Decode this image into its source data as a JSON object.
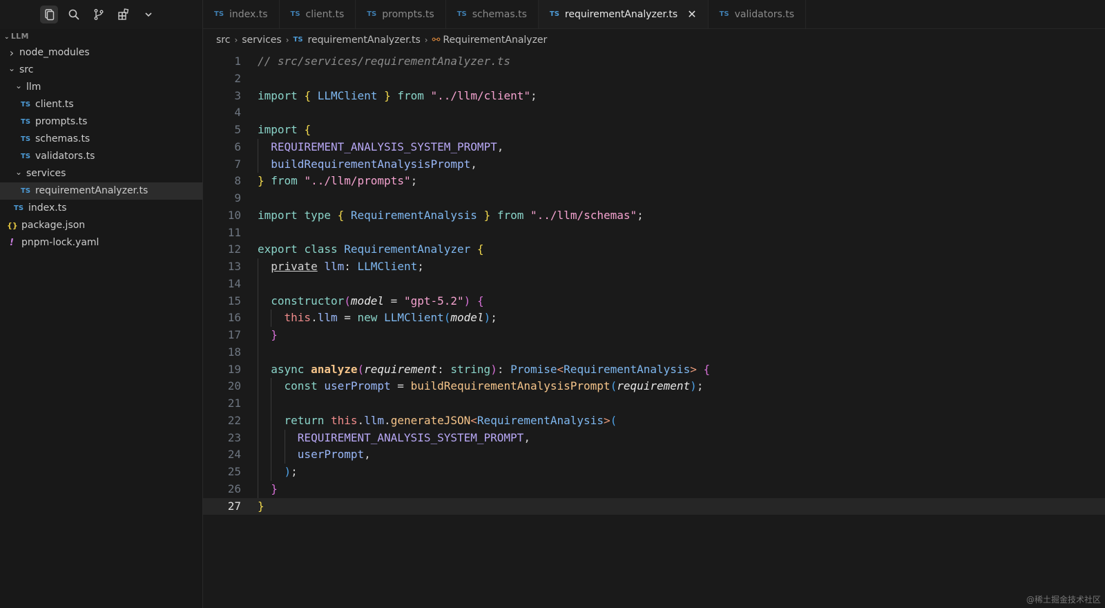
{
  "tabs": [
    {
      "badge": "TS",
      "label": "index.ts",
      "active": false
    },
    {
      "badge": "TS",
      "label": "client.ts",
      "active": false
    },
    {
      "badge": "TS",
      "label": "prompts.ts",
      "active": false
    },
    {
      "badge": "TS",
      "label": "schemas.ts",
      "active": false
    },
    {
      "badge": "TS",
      "label": "requirementAnalyzer.ts",
      "active": true
    },
    {
      "badge": "TS",
      "label": "validators.ts",
      "active": false
    }
  ],
  "explorer": {
    "root": "LLM",
    "items": [
      {
        "label": "node_modules",
        "kind": "folder",
        "open": false,
        "depth": 0
      },
      {
        "label": "src",
        "kind": "folder",
        "open": true,
        "depth": 0
      },
      {
        "label": "llm",
        "kind": "folder",
        "open": true,
        "depth": 1
      },
      {
        "label": "client.ts",
        "kind": "ts",
        "depth": 2
      },
      {
        "label": "prompts.ts",
        "kind": "ts",
        "depth": 2
      },
      {
        "label": "schemas.ts",
        "kind": "ts",
        "depth": 2
      },
      {
        "label": "validators.ts",
        "kind": "ts",
        "depth": 2
      },
      {
        "label": "services",
        "kind": "folder",
        "open": true,
        "depth": 1
      },
      {
        "label": "requirementAnalyzer.ts",
        "kind": "ts",
        "depth": 2,
        "selected": true
      },
      {
        "label": "index.ts",
        "kind": "ts",
        "depth": 1
      },
      {
        "label": "package.json",
        "kind": "json",
        "depth": 0
      },
      {
        "label": "pnpm-lock.yaml",
        "kind": "yaml",
        "depth": 0
      }
    ]
  },
  "breadcrumb": {
    "parts": [
      "src",
      "services"
    ],
    "file_badge": "TS",
    "file": "requirementAnalyzer.ts",
    "symbol": "RequirementAnalyzer"
  },
  "editor": {
    "current_line": 27,
    "lines": [
      [
        [
          "c-comment",
          "// src/services/requirementAnalyzer.ts"
        ]
      ],
      [],
      [
        [
          "c-kw",
          "import"
        ],
        [
          "c-punc",
          " "
        ],
        [
          "c-br1",
          "{"
        ],
        [
          "c-punc",
          " "
        ],
        [
          "c-type",
          "LLMClient"
        ],
        [
          "c-punc",
          " "
        ],
        [
          "c-br1",
          "}"
        ],
        [
          "c-punc",
          " "
        ],
        [
          "c-kw",
          "from"
        ],
        [
          "c-punc",
          " "
        ],
        [
          "c-str",
          "\"../llm/client\""
        ],
        [
          "c-punc",
          ";"
        ]
      ],
      [],
      [
        [
          "c-kw",
          "import"
        ],
        [
          "c-punc",
          " "
        ],
        [
          "c-br1",
          "{"
        ]
      ],
      [
        [
          "c-punc",
          "  "
        ],
        [
          "c-const",
          "REQUIREMENT_ANALYSIS_SYSTEM_PROMPT"
        ],
        [
          "c-punc",
          ","
        ]
      ],
      [
        [
          "c-punc",
          "  "
        ],
        [
          "c-var",
          "buildRequirementAnalysisPrompt"
        ],
        [
          "c-punc",
          ","
        ]
      ],
      [
        [
          "c-br1",
          "}"
        ],
        [
          "c-punc",
          " "
        ],
        [
          "c-kw",
          "from"
        ],
        [
          "c-punc",
          " "
        ],
        [
          "c-str",
          "\"../llm/prompts\""
        ],
        [
          "c-punc",
          ";"
        ]
      ],
      [],
      [
        [
          "c-kw",
          "import"
        ],
        [
          "c-punc",
          " "
        ],
        [
          "c-kw",
          "type"
        ],
        [
          "c-punc",
          " "
        ],
        [
          "c-br1",
          "{"
        ],
        [
          "c-punc",
          " "
        ],
        [
          "c-type",
          "RequirementAnalysis"
        ],
        [
          "c-punc",
          " "
        ],
        [
          "c-br1",
          "}"
        ],
        [
          "c-punc",
          " "
        ],
        [
          "c-kw",
          "from"
        ],
        [
          "c-punc",
          " "
        ],
        [
          "c-str",
          "\"../llm/schemas\""
        ],
        [
          "c-punc",
          ";"
        ]
      ],
      [],
      [
        [
          "c-kw",
          "export"
        ],
        [
          "c-punc",
          " "
        ],
        [
          "c-kw",
          "class"
        ],
        [
          "c-punc",
          " "
        ],
        [
          "c-type",
          "RequirementAnalyzer"
        ],
        [
          "c-punc",
          " "
        ],
        [
          "c-br1",
          "{"
        ]
      ],
      [
        [
          "c-punc",
          "  "
        ],
        [
          "c-punc u",
          "private"
        ],
        [
          "c-punc",
          " "
        ],
        [
          "c-var",
          "llm"
        ],
        [
          "c-punc",
          ": "
        ],
        [
          "c-type",
          "LLMClient"
        ],
        [
          "c-punc",
          ";"
        ]
      ],
      [],
      [
        [
          "c-punc",
          "  "
        ],
        [
          "c-kw",
          "constructor"
        ],
        [
          "c-br2",
          "("
        ],
        [
          "c-param",
          "model"
        ],
        [
          "c-punc",
          " = "
        ],
        [
          "c-str",
          "\"gpt-5.2\""
        ],
        [
          "c-br2",
          ")"
        ],
        [
          "c-punc",
          " "
        ],
        [
          "c-br2",
          "{"
        ]
      ],
      [
        [
          "c-punc",
          "    "
        ],
        [
          "c-this",
          "this"
        ],
        [
          "c-punc",
          "."
        ],
        [
          "c-var",
          "llm"
        ],
        [
          "c-punc",
          " = "
        ],
        [
          "c-kw",
          "new"
        ],
        [
          "c-punc",
          " "
        ],
        [
          "c-type",
          "LLMClient"
        ],
        [
          "c-br3",
          "("
        ],
        [
          "c-param",
          "model"
        ],
        [
          "c-br3",
          ")"
        ],
        [
          "c-punc",
          ";"
        ]
      ],
      [
        [
          "c-punc",
          "  "
        ],
        [
          "c-br2",
          "}"
        ]
      ],
      [],
      [
        [
          "c-punc",
          "  "
        ],
        [
          "c-kw",
          "async"
        ],
        [
          "c-punc",
          " "
        ],
        [
          "c-fnb",
          "analyze"
        ],
        [
          "c-br2",
          "("
        ],
        [
          "c-param",
          "requirement"
        ],
        [
          "c-punc",
          ": "
        ],
        [
          "c-kw",
          "string"
        ],
        [
          "c-br2",
          ")"
        ],
        [
          "c-punc",
          ": "
        ],
        [
          "c-type",
          "Promise"
        ],
        [
          "c-generic",
          "<"
        ],
        [
          "c-type",
          "RequirementAnalysis"
        ],
        [
          "c-generic",
          ">"
        ],
        [
          "c-punc",
          " "
        ],
        [
          "c-br2",
          "{"
        ]
      ],
      [
        [
          "c-punc",
          "    "
        ],
        [
          "c-kw",
          "const"
        ],
        [
          "c-punc",
          " "
        ],
        [
          "c-var",
          "userPrompt"
        ],
        [
          "c-punc",
          " = "
        ],
        [
          "c-fn",
          "buildRequirementAnalysisPrompt"
        ],
        [
          "c-br3",
          "("
        ],
        [
          "c-param",
          "requirement"
        ],
        [
          "c-br3",
          ")"
        ],
        [
          "c-punc",
          ";"
        ]
      ],
      [],
      [
        [
          "c-punc",
          "    "
        ],
        [
          "c-kw",
          "return"
        ],
        [
          "c-punc",
          " "
        ],
        [
          "c-this",
          "this"
        ],
        [
          "c-punc",
          "."
        ],
        [
          "c-var",
          "llm"
        ],
        [
          "c-punc",
          "."
        ],
        [
          "c-fn",
          "generateJSON"
        ],
        [
          "c-generic",
          "<"
        ],
        [
          "c-type",
          "RequirementAnalysis"
        ],
        [
          "c-generic",
          ">"
        ],
        [
          "c-br3",
          "("
        ]
      ],
      [
        [
          "c-punc",
          "      "
        ],
        [
          "c-const",
          "REQUIREMENT_ANALYSIS_SYSTEM_PROMPT"
        ],
        [
          "c-punc",
          ","
        ]
      ],
      [
        [
          "c-punc",
          "      "
        ],
        [
          "c-var",
          "userPrompt"
        ],
        [
          "c-punc",
          ","
        ]
      ],
      [
        [
          "c-punc",
          "    "
        ],
        [
          "c-br3",
          ")"
        ],
        [
          "c-punc",
          ";"
        ]
      ],
      [
        [
          "c-punc",
          "  "
        ],
        [
          "c-br2",
          "}"
        ]
      ],
      [
        [
          "c-br1",
          "}"
        ]
      ]
    ]
  },
  "watermark": "@稀土掘金技术社区",
  "colors": {
    "accent": "#4d9bd6",
    "background": "#1a1a1a"
  }
}
